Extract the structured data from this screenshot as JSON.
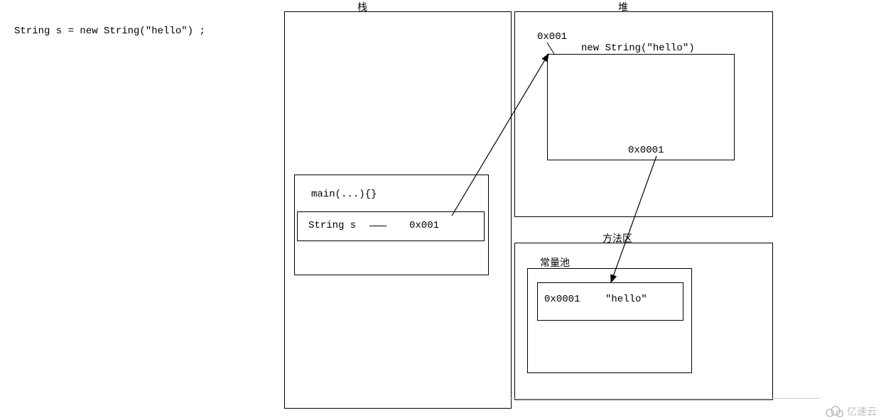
{
  "code_line": "String s = new String(\"hello\") ;",
  "stack": {
    "title": "栈",
    "frame_label": "main(...){}",
    "var_name": "String s",
    "var_value": "0x001"
  },
  "heap": {
    "title": "堆",
    "object_addr": "0x001",
    "object_expr": "new String(\"hello\")",
    "field_addr": "0x0001"
  },
  "method_area": {
    "title": "方法区",
    "pool_title": "常量池",
    "const_addr": "0x0001",
    "const_value": "\"hello\""
  },
  "watermark": "亿速云"
}
